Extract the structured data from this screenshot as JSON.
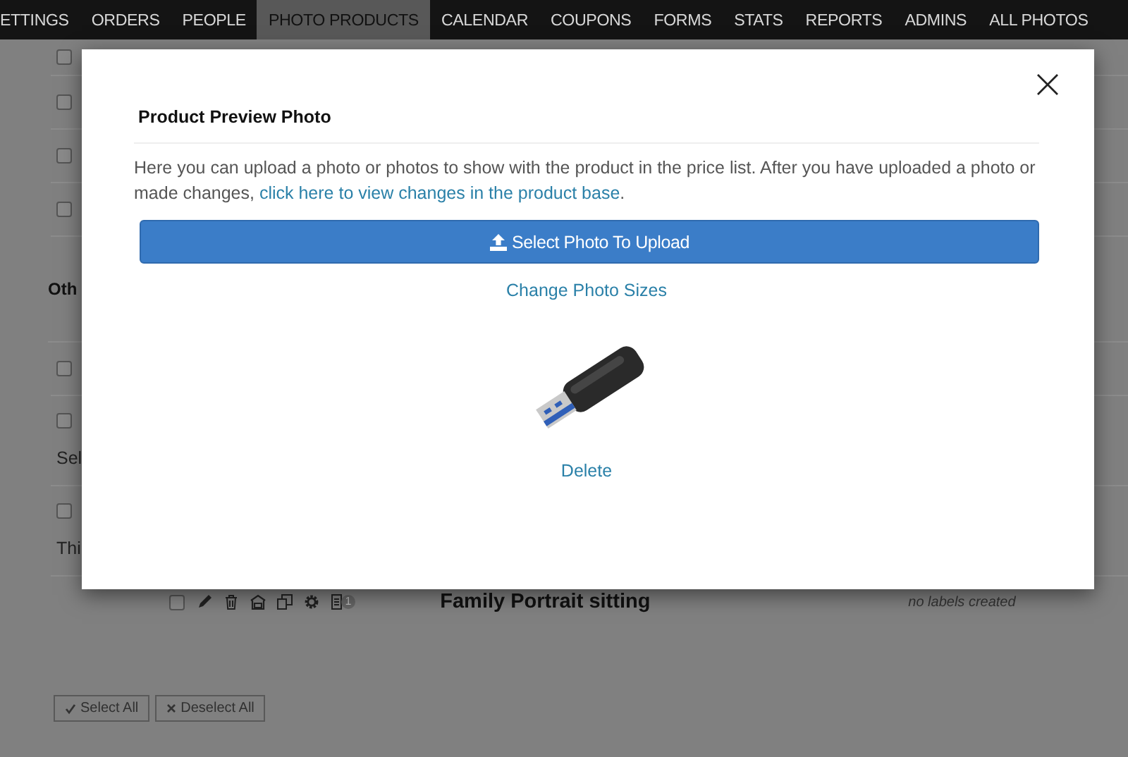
{
  "nav": [
    {
      "label": "ETTINGS",
      "selected": false
    },
    {
      "label": "ORDERS",
      "selected": false
    },
    {
      "label": "PEOPLE",
      "selected": false
    },
    {
      "label": "PHOTO PRODUCTS",
      "selected": true
    },
    {
      "label": "CALENDAR",
      "selected": false
    },
    {
      "label": "COUPONS",
      "selected": false
    },
    {
      "label": "FORMS",
      "selected": false
    },
    {
      "label": "STATS",
      "selected": false
    },
    {
      "label": "REPORTS",
      "selected": false
    },
    {
      "label": "ADMINS",
      "selected": false
    },
    {
      "label": "ALL PHOTOS",
      "selected": false
    }
  ],
  "rows": [
    {
      "kind": "check",
      "checked": false
    },
    {
      "kind": "check",
      "checked": false
    },
    {
      "kind": "check",
      "checked": false
    },
    {
      "kind": "check",
      "checked": false
    },
    {
      "kind": "heading",
      "text": "Oth"
    },
    {
      "kind": "check",
      "checked": false
    },
    {
      "kind": "check",
      "checked": false,
      "text": "Sel"
    },
    {
      "kind": "check",
      "checked": false,
      "text": "Thi"
    },
    {
      "kind": "product",
      "checked": false,
      "title": "Family Portrait sitting",
      "labels": "no labels created",
      "badge": "1"
    }
  ],
  "buttons": [
    {
      "label": "Select All"
    },
    {
      "label": "Deselect All"
    }
  ],
  "modal": {
    "title": "Product Preview Photo",
    "text": "Here you can upload a photo or photos to show with the product in the price list. After you have uploaded a photo or made changes, ",
    "link": "click here to view changes in the product base",
    "link_suffix": ".",
    "upload_button": "Select Photo To Upload",
    "sizes_link": "Change Photo Sizes",
    "delete_link": "Delete"
  }
}
